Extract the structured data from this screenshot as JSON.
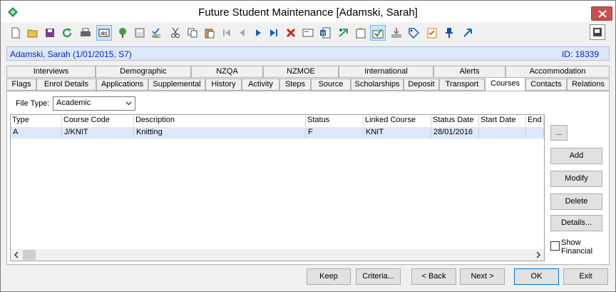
{
  "window": {
    "title": "Future Student Maintenance  [Adamski, Sarah]"
  },
  "toolbar": {
    "icons": [
      "new-icon",
      "open-folder-icon",
      "save-icon",
      "refresh-icon",
      "print-icon",
      "textfield-icon",
      "tree-icon",
      "calculator-icon",
      "spellcheck-icon",
      "cut-icon",
      "copy-icon",
      "paste-icon",
      "first-record-icon",
      "prev-record-icon",
      "next-record-icon",
      "last-record-icon",
      "delete-icon",
      "email-icon",
      "word-icon",
      "send-icon",
      "clipboard-icon",
      "approve-icon",
      "import-icon",
      "tag-icon",
      "checklist-icon",
      "pin-icon",
      "goto-icon"
    ]
  },
  "header": {
    "student": "Adamski, Sarah (1/01/2015, S7)",
    "id": "ID: 18339"
  },
  "tabs_row1": [
    "Interviews",
    "Demographic",
    "NZQA",
    "NZMOE",
    "International",
    "Alerts",
    "Accommodation"
  ],
  "tabs_row2": [
    "Flags",
    "Enrol Details",
    "Applications",
    "Supplemental",
    "History",
    "Activity",
    "Steps",
    "Source",
    "Scholarships",
    "Deposit",
    "Transport",
    "Courses",
    "Contacts",
    "Relations"
  ],
  "selected_tab": "Courses",
  "filetype": {
    "label": "File Type:",
    "value": "Academic"
  },
  "grid": {
    "columns": [
      "Type",
      "Course Code",
      "Description",
      "Status",
      "Linked Course",
      "Status Date",
      "Start Date",
      "End"
    ],
    "rows": [
      [
        "A",
        "J/KNIT",
        "Knitting",
        "F",
        "KNIT",
        "28/01/2016",
        "",
        ""
      ]
    ]
  },
  "side": {
    "ellipsis": "...",
    "add": "Add",
    "modify": "Modify",
    "delete": "Delete",
    "details": "Details...",
    "show_financial": "Show Financial"
  },
  "footer": {
    "keep": "Keep",
    "criteria": "Criteria...",
    "back": "< Back",
    "next": "Next >",
    "ok": "OK",
    "exit": "Exit"
  }
}
